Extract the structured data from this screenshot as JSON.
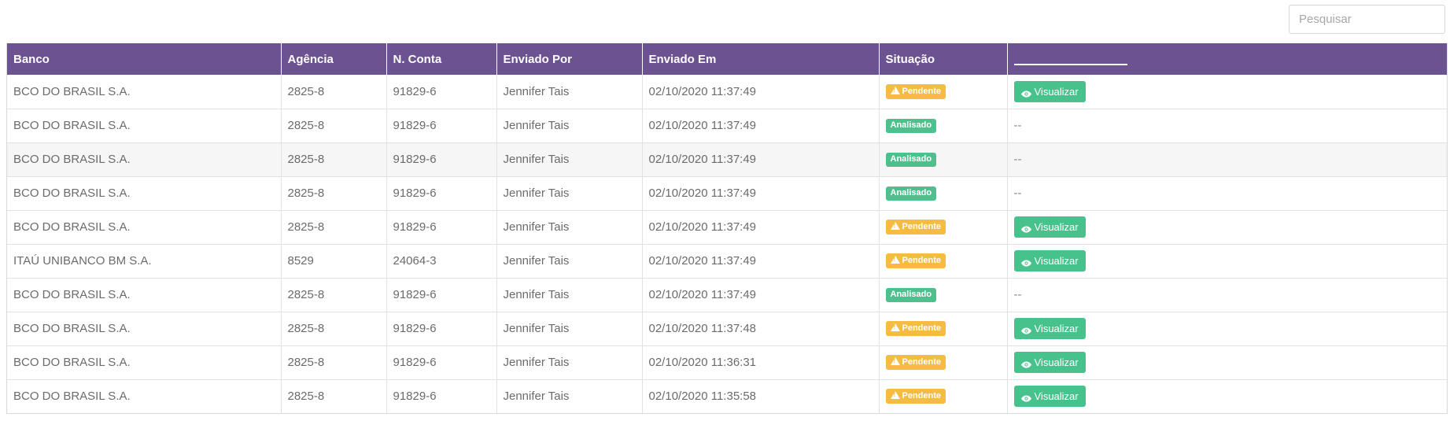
{
  "search": {
    "placeholder": "Pesquisar",
    "value": ""
  },
  "table": {
    "headers": [
      "Banco",
      "Agência",
      "N. Conta",
      "Enviado Por",
      "Enviado Em",
      "Situação",
      ""
    ],
    "rows": [
      {
        "banco": "BCO DO BRASIL S.A.",
        "agencia": "2825-8",
        "conta": "91829-6",
        "enviado_por": "Jennifer Tais",
        "enviado_em": "02/10/2020 11:37:49",
        "situacao": "Pendente",
        "acao": "Visualizar"
      },
      {
        "banco": "BCO DO BRASIL S.A.",
        "agencia": "2825-8",
        "conta": "91829-6",
        "enviado_por": "Jennifer Tais",
        "enviado_em": "02/10/2020 11:37:49",
        "situacao": "Analisado",
        "acao": "--"
      },
      {
        "banco": "BCO DO BRASIL S.A.",
        "agencia": "2825-8",
        "conta": "91829-6",
        "enviado_por": "Jennifer Tais",
        "enviado_em": "02/10/2020 11:37:49",
        "situacao": "Analisado",
        "acao": "--"
      },
      {
        "banco": "BCO DO BRASIL S.A.",
        "agencia": "2825-8",
        "conta": "91829-6",
        "enviado_por": "Jennifer Tais",
        "enviado_em": "02/10/2020 11:37:49",
        "situacao": "Analisado",
        "acao": "--"
      },
      {
        "banco": "BCO DO BRASIL S.A.",
        "agencia": "2825-8",
        "conta": "91829-6",
        "enviado_por": "Jennifer Tais",
        "enviado_em": "02/10/2020 11:37:49",
        "situacao": "Pendente",
        "acao": "Visualizar"
      },
      {
        "banco": "ITAÚ UNIBANCO BM S.A.",
        "agencia": "8529",
        "conta": "24064-3",
        "enviado_por": "Jennifer Tais",
        "enviado_em": "02/10/2020 11:37:49",
        "situacao": "Pendente",
        "acao": "Visualizar"
      },
      {
        "banco": "BCO DO BRASIL S.A.",
        "agencia": "2825-8",
        "conta": "91829-6",
        "enviado_por": "Jennifer Tais",
        "enviado_em": "02/10/2020 11:37:49",
        "situacao": "Analisado",
        "acao": "--"
      },
      {
        "banco": "BCO DO BRASIL S.A.",
        "agencia": "2825-8",
        "conta": "91829-6",
        "enviado_por": "Jennifer Tais",
        "enviado_em": "02/10/2020 11:37:48",
        "situacao": "Pendente",
        "acao": "Visualizar"
      },
      {
        "banco": "BCO DO BRASIL S.A.",
        "agencia": "2825-8",
        "conta": "91829-6",
        "enviado_por": "Jennifer Tais",
        "enviado_em": "02/10/2020 11:36:31",
        "situacao": "Pendente",
        "acao": "Visualizar"
      },
      {
        "banco": "BCO DO BRASIL S.A.",
        "agencia": "2825-8",
        "conta": "91829-6",
        "enviado_por": "Jennifer Tais",
        "enviado_em": "02/10/2020 11:35:58",
        "situacao": "Pendente",
        "acao": "Visualizar"
      }
    ]
  },
  "icons": {
    "pending_badge": "warning-icon",
    "view_button": "eye-icon"
  },
  "colors": {
    "header_bg": "#6d5291",
    "pending": "#f6bb42",
    "analyzed": "#4fc08d",
    "view_button": "#47c28d"
  }
}
